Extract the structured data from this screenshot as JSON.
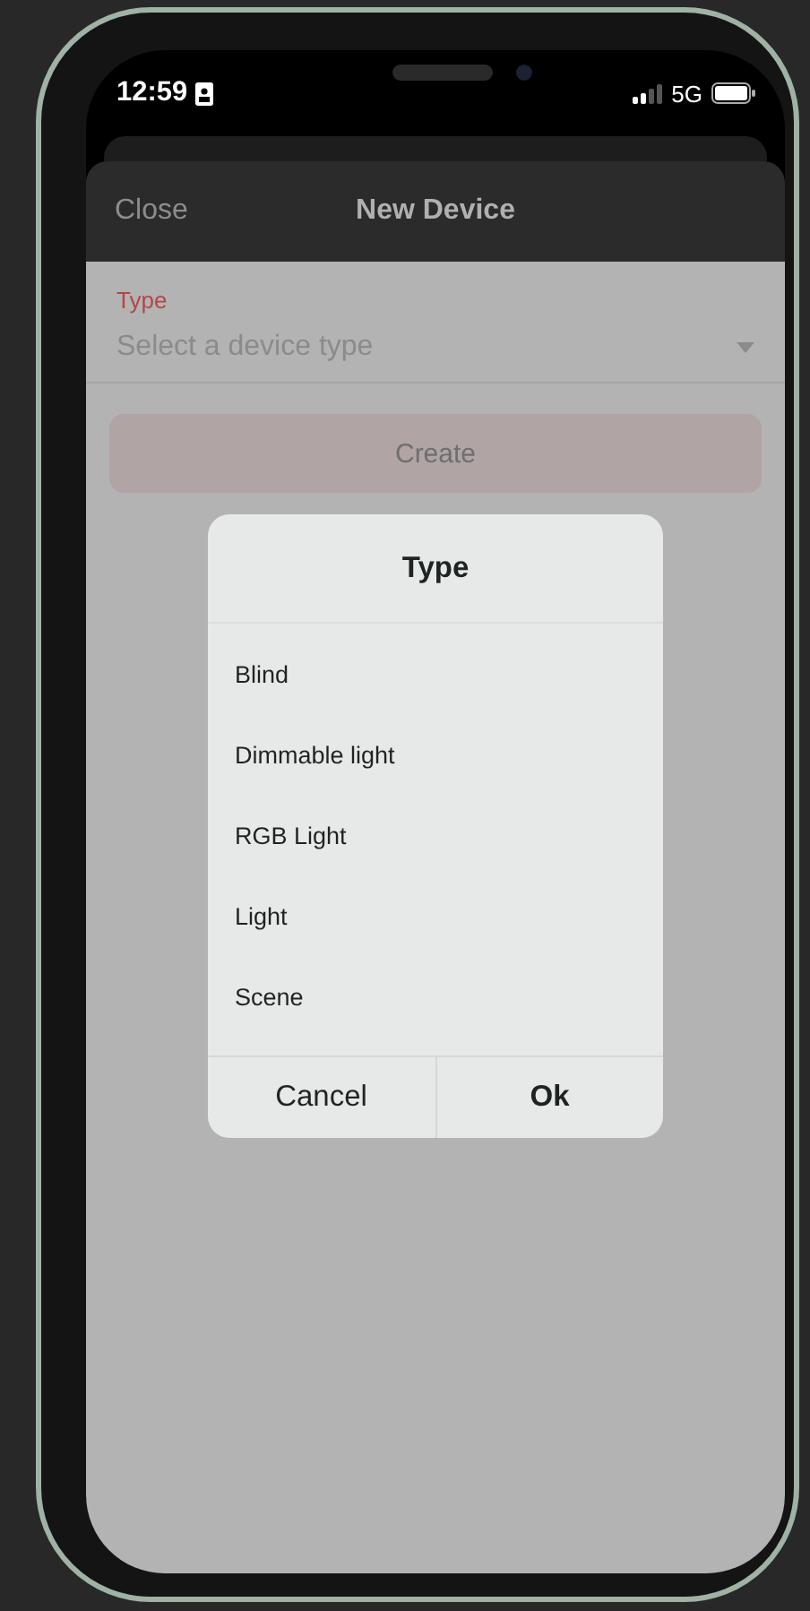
{
  "status_bar": {
    "time": "12:59",
    "network": "5G"
  },
  "header": {
    "close": "Close",
    "title": "New Device"
  },
  "form": {
    "label": "Type",
    "placeholder": "Select a device type",
    "button": {
      "label": "Create",
      "disabled": true
    }
  },
  "dialog": {
    "title": "Type",
    "options": [
      {
        "label": "Blind"
      },
      {
        "label": "Dimmable light"
      },
      {
        "label": "RGB Light"
      },
      {
        "label": "Light"
      },
      {
        "label": "Scene"
      }
    ],
    "buttons": [
      {
        "label": "Cancel",
        "kind": "secondary"
      },
      {
        "label": "Ok",
        "kind": "primary"
      }
    ]
  }
}
